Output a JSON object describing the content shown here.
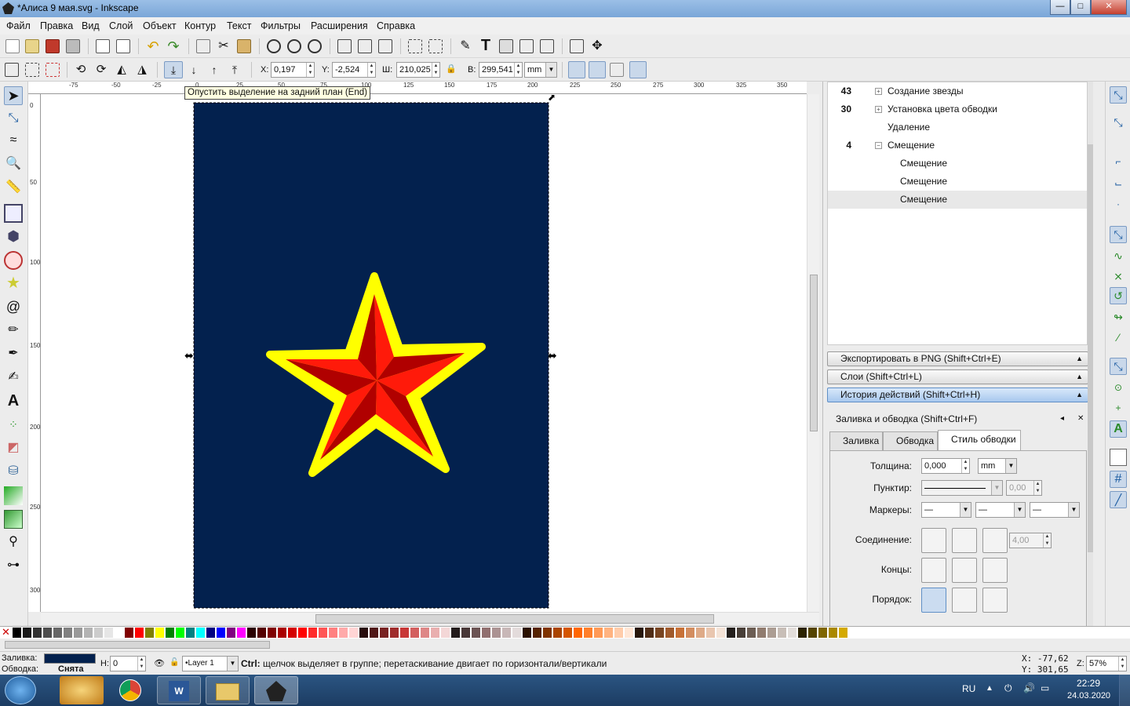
{
  "window": {
    "title": "*Алиса 9 мая.svg - Inkscape",
    "minimize": "—",
    "maximize": "□",
    "close": "✕"
  },
  "menu": [
    "Файл",
    "Правка",
    "Вид",
    "Слой",
    "Объект",
    "Контур",
    "Текст",
    "Фильтры",
    "Расширения",
    "Справка"
  ],
  "selector_toolbar": {
    "x_label": "X:",
    "x_value": "0,197",
    "y_label": "Y:",
    "y_value": "-2,524",
    "w_label": "Ш:",
    "w_value": "210,025",
    "h_label": "В:",
    "h_value": "299,541",
    "unit": "mm"
  },
  "tooltip": "Опустить выделение на задний план (End)",
  "ruler_top_ticks": [
    "-75",
    "-50",
    "-25",
    "0",
    "25",
    "50",
    "75",
    "100",
    "125",
    "150",
    "175",
    "200",
    "225",
    "250",
    "275",
    "300",
    "325",
    "350"
  ],
  "ruler_left_ticks": [
    "0",
    "50",
    "100",
    "150",
    "200",
    "250",
    "300"
  ],
  "history": [
    {
      "count": "43",
      "expander": "+",
      "label": "Создание звезды",
      "indent": 0
    },
    {
      "count": "30",
      "expander": "+",
      "label": "Установка цвета обводки",
      "indent": 0
    },
    {
      "count": "",
      "expander": "",
      "label": "Удаление",
      "indent": 0
    },
    {
      "count": "4",
      "expander": "−",
      "label": "Смещение",
      "indent": 0
    },
    {
      "count": "",
      "expander": "",
      "label": "Смещение",
      "indent": 1
    },
    {
      "count": "",
      "expander": "",
      "label": "Смещение",
      "indent": 1
    },
    {
      "count": "",
      "expander": "",
      "label": "Смещение",
      "indent": 1,
      "selected": true
    }
  ],
  "dock_panels": [
    {
      "label": "Экспортировать в PNG (Shift+Ctrl+E)",
      "active": false
    },
    {
      "label": "Слои (Shift+Ctrl+L)",
      "active": false
    },
    {
      "label": "История действий (Shift+Ctrl+H)",
      "active": true
    }
  ],
  "fill_stroke": {
    "title": "Заливка и обводка (Shift+Ctrl+F)",
    "tabs": [
      "Заливка",
      "Обводка",
      "Стиль обводки"
    ],
    "width_label": "Толщина:",
    "width_value": "0,000",
    "width_unit": "mm",
    "dash_label": "Пунктир:",
    "dash_value": "0,00",
    "markers_label": "Маркеры:",
    "marker_value": "—",
    "join_label": "Соединение:",
    "miter_value": "4,00",
    "cap_label": "Концы:",
    "order_label": "Порядок:"
  },
  "status": {
    "fill_label": "Заливка:",
    "stroke_label": "Обводка:",
    "stroke_value": "Снята",
    "opacity_label": "Н:",
    "opacity_value": "0",
    "layer": "•Layer 1",
    "message_bold": "Ctrl:",
    "message": " щелчок выделяет в группе; перетаскивание двигает по горизонтали/вертикали",
    "cursor_x_label": "X:",
    "cursor_x": "-77,62",
    "cursor_y_label": "Y:",
    "cursor_y": "301,65",
    "zoom_label": "Z:",
    "zoom": "57%",
    "fill_color": "#03214e"
  },
  "canvas": {
    "page_color": "#03214e",
    "star_outer": "#ffff00",
    "star_light": "#ff1a0a",
    "star_dark": "#b00000"
  },
  "taskbar": {
    "lang": "RU",
    "time": "22:29",
    "date": "24.03.2020"
  },
  "palette": [
    "#000000",
    "#1a1a1a",
    "#333333",
    "#4d4d4d",
    "#666666",
    "#808080",
    "#999999",
    "#b3b3b3",
    "#cccccc",
    "#e6e6e6",
    "#ffffff",
    "#800000",
    "#ff0000",
    "#808000",
    "#ffff00",
    "#008000",
    "#00ff00",
    "#008080",
    "#00ffff",
    "#000080",
    "#0000ff",
    "#800080",
    "#ff00ff",
    "#2b0000",
    "#550000",
    "#800000",
    "#aa0000",
    "#d40000",
    "#ff0000",
    "#ff2a2a",
    "#ff5555",
    "#ff8080",
    "#ffaaaa",
    "#ffd5d5",
    "#280b0b",
    "#501616",
    "#782121",
    "#a02c2c",
    "#c83737",
    "#d35f5f",
    "#de8787",
    "#e9afaf",
    "#f4d7d7",
    "#241c1c",
    "#483737",
    "#6c5353",
    "#916f6f",
    "#ac9393",
    "#c8b7b7",
    "#e3dbdb",
    "#2b1100",
    "#552200",
    "#803300",
    "#aa4400",
    "#d45500",
    "#ff6600",
    "#ff7f2a",
    "#ff9955",
    "#ffb380",
    "#ffccaa",
    "#ffe6d5",
    "#28170b",
    "#502d16",
    "#784421",
    "#a05a2c",
    "#c87137",
    "#d38d5f",
    "#deaa87",
    "#e9c6af",
    "#f4e3d7",
    "#241f1c",
    "#483e37",
    "#6c5d53",
    "#917c6f",
    "#ac9d93",
    "#c8beb7",
    "#e3dedb",
    "#2b2200",
    "#554400",
    "#806600",
    "#aa8800",
    "#d4aa00"
  ]
}
